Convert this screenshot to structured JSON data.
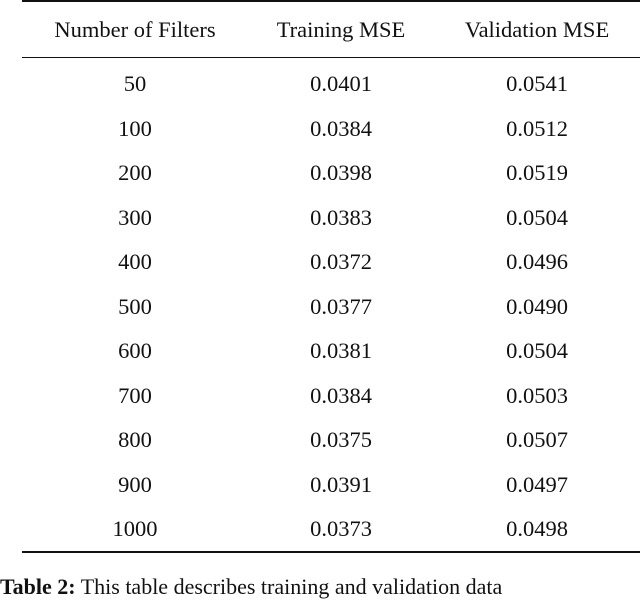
{
  "table": {
    "headers": [
      "Number of Filters",
      "Training MSE",
      "Validation MSE"
    ],
    "rows": [
      [
        "50",
        "0.0401",
        "0.0541"
      ],
      [
        "100",
        "0.0384",
        "0.0512"
      ],
      [
        "200",
        "0.0398",
        "0.0519"
      ],
      [
        "300",
        "0.0383",
        "0.0504"
      ],
      [
        "400",
        "0.0372",
        "0.0496"
      ],
      [
        "500",
        "0.0377",
        "0.0490"
      ],
      [
        "600",
        "0.0381",
        "0.0504"
      ],
      [
        "700",
        "0.0384",
        "0.0503"
      ],
      [
        "800",
        "0.0375",
        "0.0507"
      ],
      [
        "900",
        "0.0391",
        "0.0497"
      ],
      [
        "1000",
        "0.0373",
        "0.0498"
      ]
    ]
  },
  "caption": {
    "label": "Table 2:",
    "text": "This table describes training and validation data"
  }
}
